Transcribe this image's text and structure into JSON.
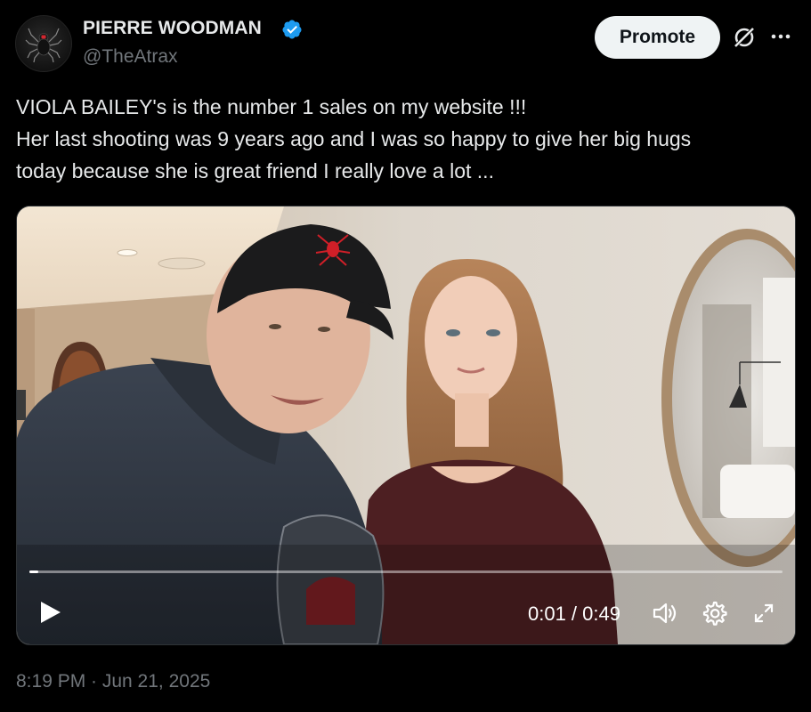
{
  "author": {
    "display_name": "PIERRE WOODMAN",
    "handle": "@TheAtrax",
    "verified": true,
    "verified_color": "#1d9bf0",
    "avatar_icon": "spider-logo"
  },
  "header_actions": {
    "promote_label": "Promote",
    "grok_icon": "grok-icon",
    "more_icon": "more-dots-icon"
  },
  "tweet": {
    "lines": [
      "VIOLA BAILEY's is the number 1 sales on my website !!!",
      "Her last shooting was 9 years ago and I was so happy to give her big hugs",
      "today because she is great friend I really love a lot ..."
    ]
  },
  "video": {
    "current_time": "0:01",
    "duration": "0:49",
    "time_display": "0:01 / 0:49",
    "progress_fraction": 0.012,
    "controls": [
      "play-icon",
      "volume-icon",
      "settings-gear-icon",
      "fullscreen-icon"
    ]
  },
  "timestamp": "8:19 PM · Jun 21, 2025",
  "colors": {
    "background": "#000000",
    "text": "#e7e9ea",
    "secondary_text": "#71767b",
    "button_bg": "#eff3f4"
  }
}
